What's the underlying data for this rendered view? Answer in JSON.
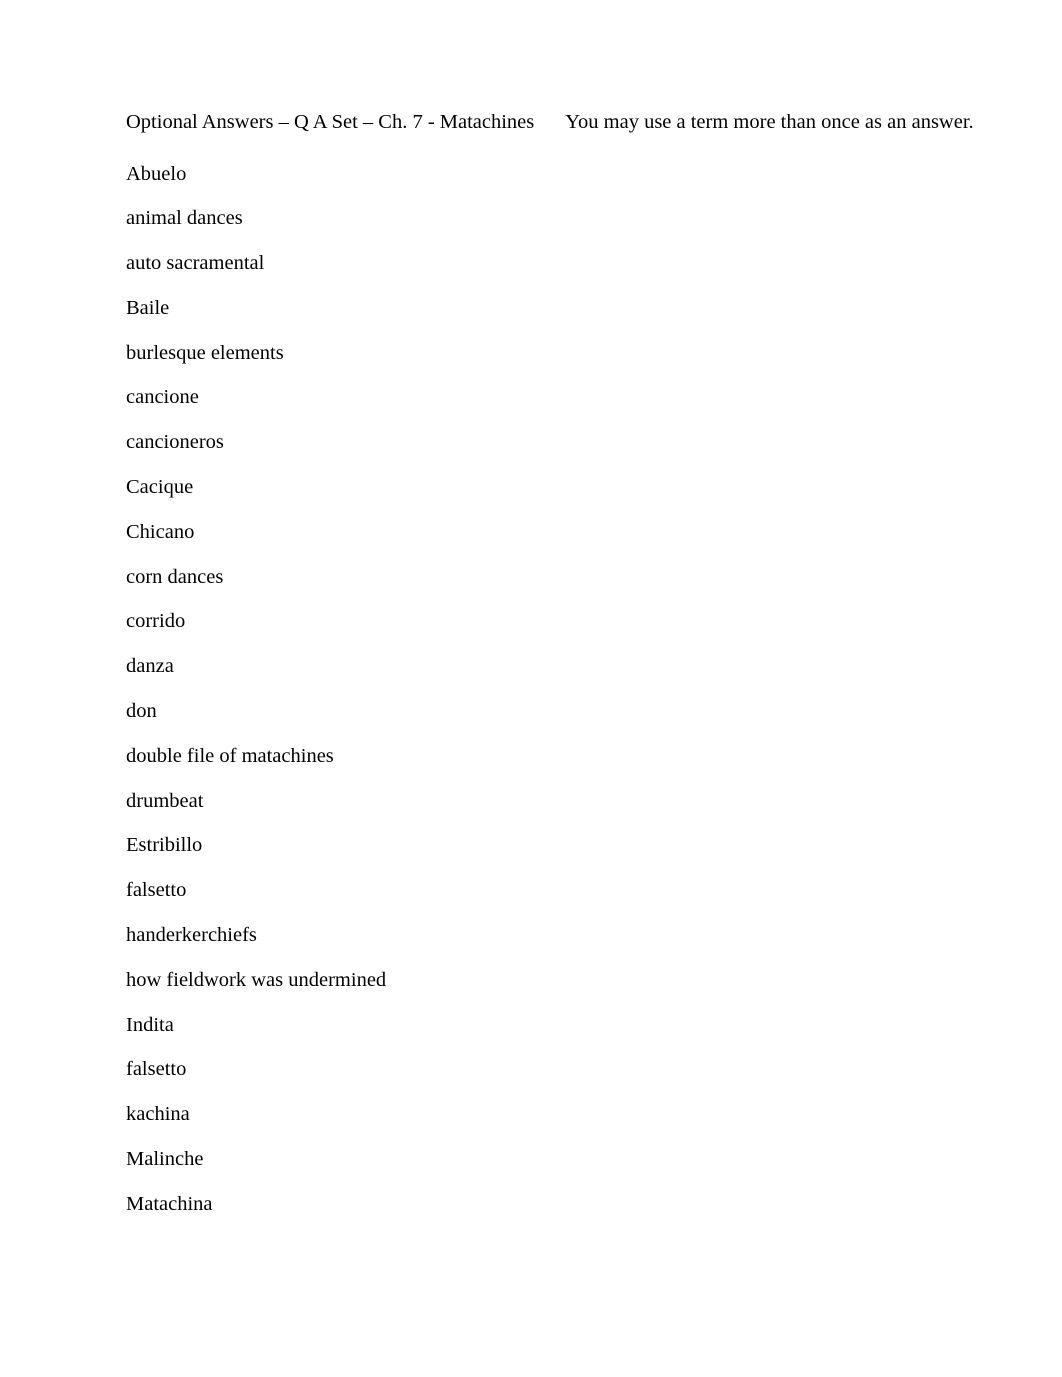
{
  "document": {
    "header": {
      "title": "Optional Answers – Q A Set – Ch. 7 - Matachines",
      "note": "You may use a term more than once as an answer."
    },
    "terms": [
      "Abuelo",
      "animal dances",
      "auto sacramental",
      "Baile",
      "burlesque elements",
      "cancione",
      "cancioneros",
      "Cacique",
      "Chicano",
      "corn dances",
      "corrido",
      "danza",
      "don",
      "double file of matachines",
      "drumbeat",
      "Estribillo",
      "falsetto",
      "handerkerchiefs",
      "how fieldwork was undermined",
      "Indita",
      "falsetto",
      "kachina",
      "Malinche",
      "Matachina"
    ]
  }
}
